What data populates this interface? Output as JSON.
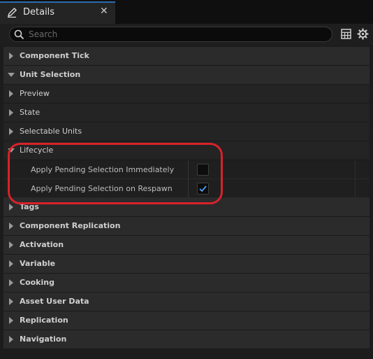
{
  "tab": {
    "title": "Details",
    "close": "✕",
    "icon": "pencil-icon"
  },
  "search": {
    "placeholder": "Search",
    "value": ""
  },
  "toolbar": {
    "table_icon": "table-view-icon",
    "settings_icon": "gear-icon"
  },
  "colors": {
    "accent": "#2c6db0",
    "highlight": "#d8222a",
    "checkmark": "#4aa3ff"
  },
  "categories_top": [
    {
      "label": "Component Tick",
      "expanded": false
    },
    {
      "label": "Unit Selection",
      "expanded": true
    },
    {
      "label": "Preview",
      "expanded": false
    },
    {
      "label": "State",
      "expanded": false
    },
    {
      "label": "Selectable Units",
      "expanded": false
    },
    {
      "label": "Lifecycle",
      "expanded": true
    }
  ],
  "lifecycle_properties": [
    {
      "label": "Apply Pending Selection Immediately",
      "checked": false
    },
    {
      "label": "Apply Pending Selection on Respawn",
      "checked": true
    }
  ],
  "categories_bottom": [
    {
      "label": "Tags"
    },
    {
      "label": "Component Replication"
    },
    {
      "label": "Activation"
    },
    {
      "label": "Variable"
    },
    {
      "label": "Cooking"
    },
    {
      "label": "Asset User Data"
    },
    {
      "label": "Replication"
    },
    {
      "label": "Navigation"
    }
  ]
}
